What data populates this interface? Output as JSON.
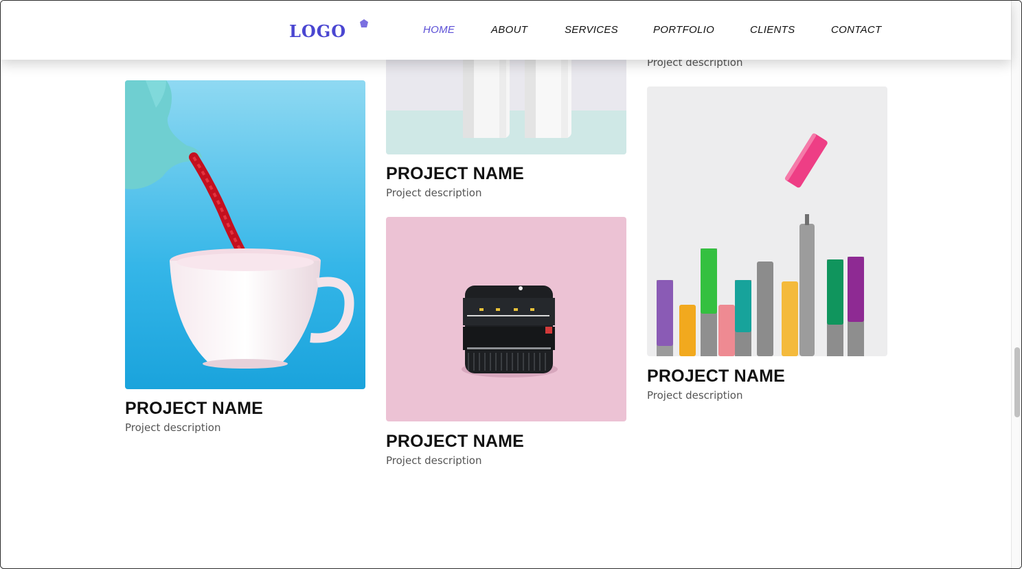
{
  "header": {
    "logo_text": "LOGO",
    "nav": [
      {
        "label": "HOME",
        "active": true
      },
      {
        "label": "ABOUT",
        "active": false
      },
      {
        "label": "SERVICES",
        "active": false
      },
      {
        "label": "PORTFOLIO",
        "active": false
      },
      {
        "label": "CLIENTS",
        "active": false
      },
      {
        "label": "CONTACT",
        "active": false
      }
    ]
  },
  "projects": [
    {
      "name": "PROJECT NAME",
      "description": "Project description",
      "image": "teapot-pouring-red-licorice-into-cup"
    },
    {
      "name": "PROJECT NAME",
      "description": "Project description",
      "image": "white-bottles"
    },
    {
      "name": "PROJECT NAME",
      "description": "Project description",
      "image": "camera-lens-on-pink"
    },
    {
      "name": "PROJECT NAME",
      "description": "Project description",
      "image": "colorful-markers"
    }
  ],
  "partial": {
    "col3_description": "Project description"
  },
  "colors": {
    "accent": "#5b4fd6",
    "text": "#111111",
    "muted": "#555555"
  }
}
